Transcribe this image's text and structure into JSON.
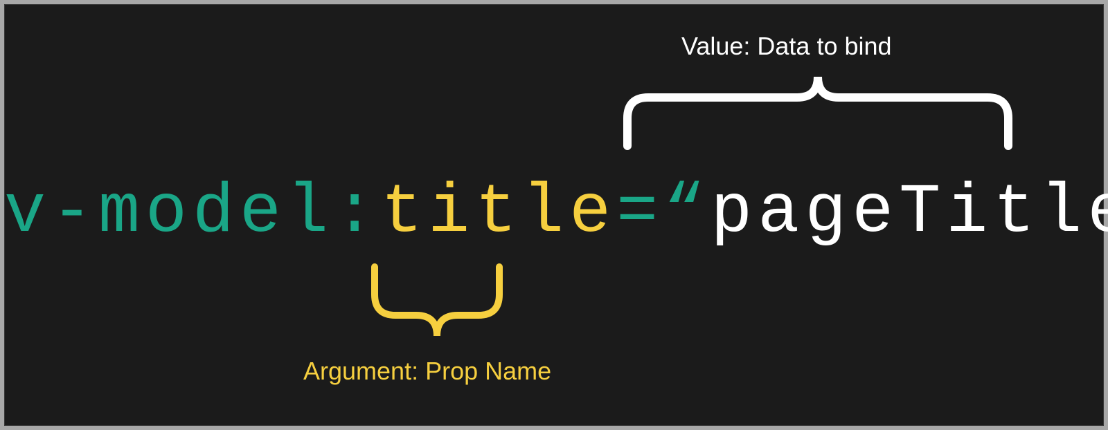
{
  "code": {
    "directive": "v-model",
    "colon": ":",
    "argument": "title",
    "equals": "=",
    "open_quote": "“",
    "value": "pageTitle",
    "close_quote": "”"
  },
  "labels": {
    "value": "Value: Data to bind",
    "argument": "Argument: Prop Name"
  },
  "colors": {
    "teal": "#1aa687",
    "yellow": "#f6cf3f",
    "white": "#ffffff",
    "bg": "#1b1b1b"
  }
}
